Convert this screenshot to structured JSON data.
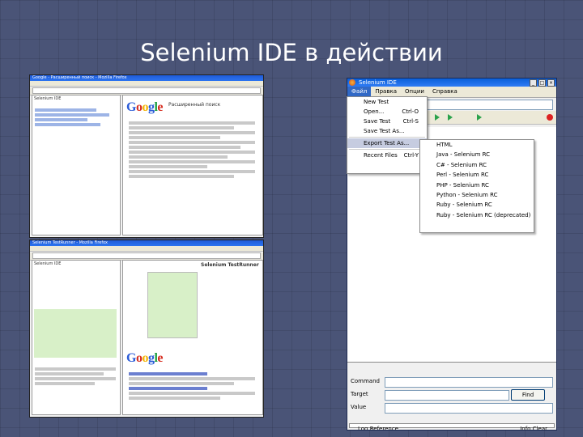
{
  "slide": {
    "title": "Selenium IDE в действии"
  },
  "colors": {
    "background": "#4a5477",
    "title": "#ffffff",
    "xp_title": "#1f5bd8",
    "menu_highlight": "#3169c6",
    "record": "#dd2222"
  },
  "top_screenshot": {
    "window_title": "Google - Расширенный поиск - Mozilla Firefox",
    "side_label": "Selenium IDE",
    "page_heading": "Расширенный поиск",
    "logo": "Google"
  },
  "bottom_screenshot": {
    "window_title": "Selenium TestRunner - Mozilla Firefox",
    "side_label": "Selenium IDE",
    "runner_title": "Selenium TestRunner",
    "logo": "Google"
  },
  "ide": {
    "title": "Selenium IDE",
    "menu": [
      "Файл",
      "Правка",
      "Опции",
      "Справка"
    ],
    "file_menu": {
      "items": [
        {
          "label": "New Test",
          "shortcut": ""
        },
        {
          "label": "Open...",
          "shortcut": "Ctrl-O"
        },
        {
          "label": "Save Test",
          "shortcut": "Ctrl-S"
        },
        {
          "label": "Save Test As...",
          "shortcut": ""
        },
        {
          "label": "Export Test As...",
          "shortcut": ""
        },
        {
          "label": "Recent Files",
          "shortcut": "Ctrl-Y"
        }
      ]
    },
    "export_submenu": [
      "HTML",
      "Java - Selenium RC",
      "C# - Selenium RC",
      "Perl - Selenium RC",
      "PHP - Selenium RC",
      "Python - Selenium RC",
      "Ruby - Selenium RC",
      "Ruby - Selenium RC (deprecated)"
    ],
    "fields": {
      "command": "Command",
      "target": "Target",
      "value": "Value",
      "find_button": "Find"
    },
    "log": {
      "left": "Log  Reference",
      "right": "Info  Clear"
    }
  }
}
